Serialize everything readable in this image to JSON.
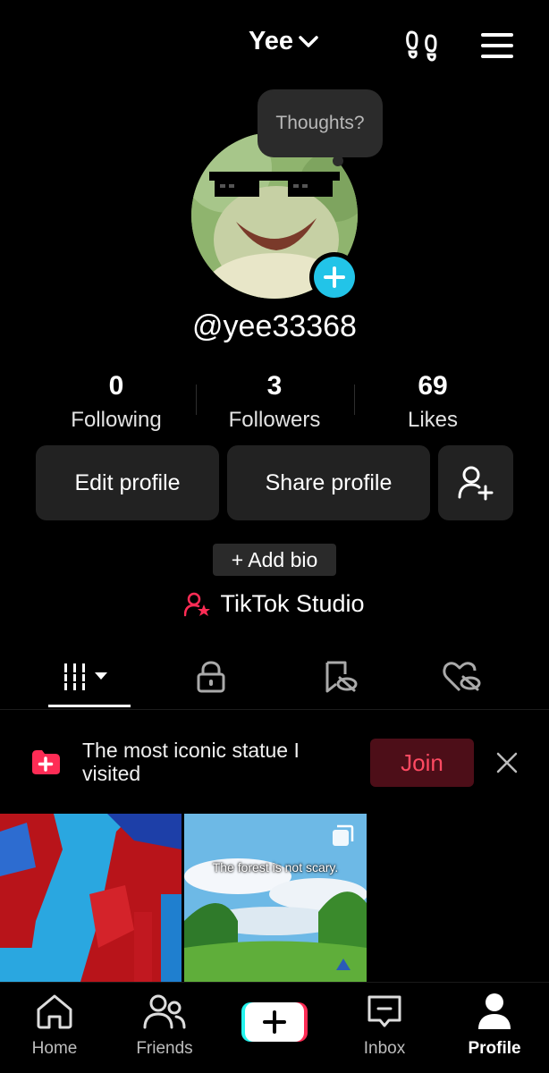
{
  "header": {
    "account_name": "Yee"
  },
  "thought_bubble": "Thoughts?",
  "profile": {
    "handle": "@yee33368"
  },
  "stats": [
    {
      "value": "0",
      "label": "Following"
    },
    {
      "value": "3",
      "label": "Followers"
    },
    {
      "value": "69",
      "label": "Likes"
    }
  ],
  "buttons": {
    "edit_profile": "Edit profile",
    "share_profile": "Share profile"
  },
  "add_bio": "+ Add bio",
  "studio_label": "TikTok Studio",
  "promo": {
    "text": "The most iconic statue I visited",
    "join_label": "Join"
  },
  "thumbnails": [
    {
      "caption": ""
    },
    {
      "caption": "The forest is not scary."
    }
  ],
  "bottom_nav": [
    {
      "label": "Home",
      "icon": "home-icon"
    },
    {
      "label": "Friends",
      "icon": "friends-icon"
    },
    {
      "label": "",
      "icon": "create-plus-icon"
    },
    {
      "label": "Inbox",
      "icon": "inbox-icon"
    },
    {
      "label": "Profile",
      "icon": "profile-icon"
    }
  ],
  "colors": {
    "accent_cyan": "#22c4e8",
    "accent_red": "#fe2c55",
    "join_bg": "#4d0e18"
  }
}
